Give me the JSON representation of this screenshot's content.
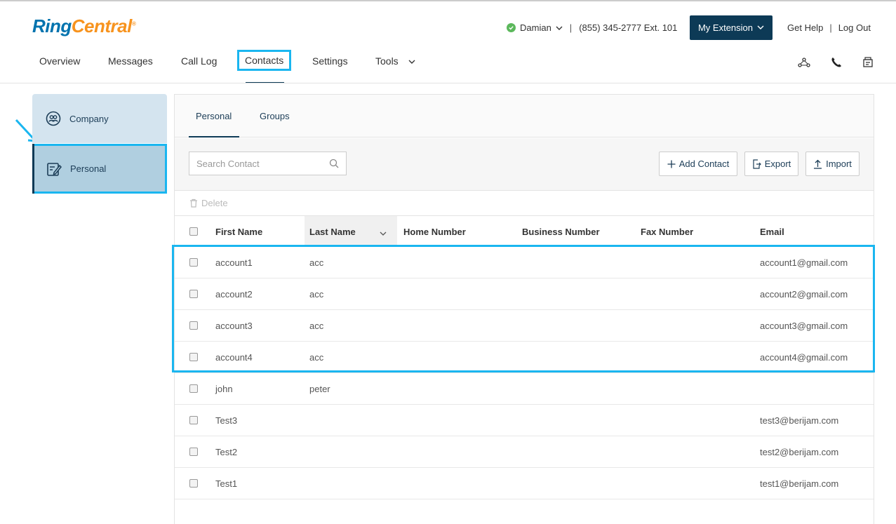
{
  "header": {
    "logo_ring": "Ring",
    "logo_central": "Central",
    "logo_mark": "®",
    "user_name": "Damian",
    "separator": "|",
    "phone": "(855) 345-2777 Ext. 101",
    "extension_button": "My Extension",
    "get_help": "Get Help",
    "log_out": "Log Out"
  },
  "nav": {
    "items": [
      "Overview",
      "Messages",
      "Call Log",
      "Contacts",
      "Settings",
      "Tools"
    ],
    "active": "Contacts"
  },
  "sidebar": {
    "company": "Company",
    "personal": "Personal"
  },
  "subtabs": {
    "personal": "Personal",
    "groups": "Groups"
  },
  "toolbar": {
    "search_placeholder": "Search Contact",
    "add_contact": "Add Contact",
    "export": "Export",
    "import": "Import",
    "delete": "Delete"
  },
  "table": {
    "columns": [
      "First Name",
      "Last Name",
      "Home Number",
      "Business Number",
      "Fax Number",
      "Email"
    ],
    "rows": [
      {
        "first": "account1",
        "last": "acc",
        "home": "",
        "business": "",
        "fax": "",
        "email": "account1@gmail.com"
      },
      {
        "first": "account2",
        "last": "acc",
        "home": "",
        "business": "",
        "fax": "",
        "email": "account2@gmail.com"
      },
      {
        "first": "account3",
        "last": "acc",
        "home": "",
        "business": "",
        "fax": "",
        "email": "account3@gmail.com"
      },
      {
        "first": "account4",
        "last": "acc",
        "home": "",
        "business": "",
        "fax": "",
        "email": "account4@gmail.com"
      },
      {
        "first": "john",
        "last": "peter",
        "home": "",
        "business": "",
        "fax": "",
        "email": ""
      },
      {
        "first": "Test3",
        "last": "",
        "home": "",
        "business": "",
        "fax": "",
        "email": "test3@berijam.com"
      },
      {
        "first": "Test2",
        "last": "",
        "home": "",
        "business": "",
        "fax": "",
        "email": "test2@berijam.com"
      },
      {
        "first": "Test1",
        "last": "",
        "home": "",
        "business": "",
        "fax": "",
        "email": "test1@berijam.com"
      }
    ]
  },
  "colors": {
    "brand_blue": "#0073ae",
    "brand_orange": "#f7931e",
    "navy": "#0d3a56",
    "highlight": "#1ab6f0",
    "status_green": "#5cb85c"
  },
  "icons": [
    "check-icon",
    "chevron-down-icon",
    "network-icon",
    "phone-icon",
    "fax-icon",
    "company-icon",
    "personal-edit-icon",
    "arrow-icon",
    "search-icon",
    "plus-icon",
    "export-icon",
    "import-icon",
    "trash-icon"
  ]
}
